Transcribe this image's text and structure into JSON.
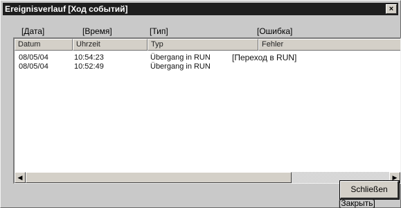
{
  "window": {
    "title": "Ereignisverlauf",
    "title_ru": "[Ход событий]",
    "close_glyph": "×"
  },
  "annotations": {
    "date": "[Дата]",
    "time": "[Время]",
    "type": "[Тип]",
    "error": "[Ошибка]",
    "row1_type": "[Переход в RUN]",
    "close": "[Закрыть]"
  },
  "table": {
    "columns": [
      "Datum",
      "Uhrzeit",
      "Typ",
      "Fehler"
    ],
    "rows": [
      [
        "08/05/04",
        "10:54:23",
        "Übergang in RUN",
        ""
      ],
      [
        "08/05/04",
        "10:52:49",
        "Übergang in RUN",
        ""
      ]
    ]
  },
  "scrollbar": {
    "left_arrow": "◀",
    "right_arrow": "▶"
  },
  "buttons": {
    "close_label": "Schließen"
  },
  "colors": {
    "titlebar": "#1e1e1e",
    "dialog_bg": "#c9c9c9",
    "list_bg": "#ffffff"
  }
}
